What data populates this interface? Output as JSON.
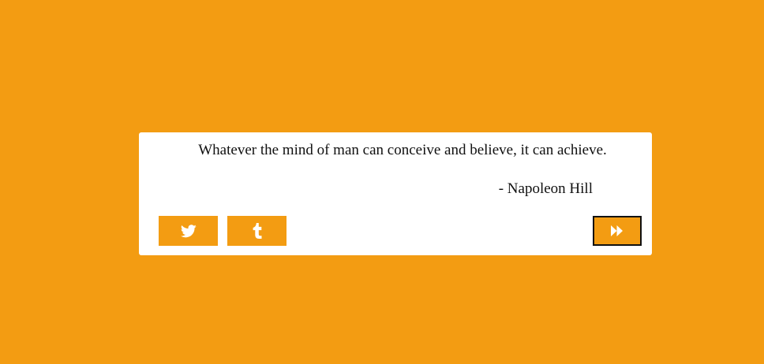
{
  "quote": {
    "text": "Whatever the mind of man can conceive and believe, it can achieve.",
    "author": "- Napoleon Hill"
  },
  "buttons": {
    "twitter": {
      "icon": "twitter-icon"
    },
    "tumblr": {
      "icon": "tumblr-icon"
    },
    "next": {
      "icon": "fast-forward-icon"
    }
  },
  "colors": {
    "background": "#f39c12",
    "card": "#ffffff",
    "text": "#111111",
    "icon": "#ffffff"
  }
}
